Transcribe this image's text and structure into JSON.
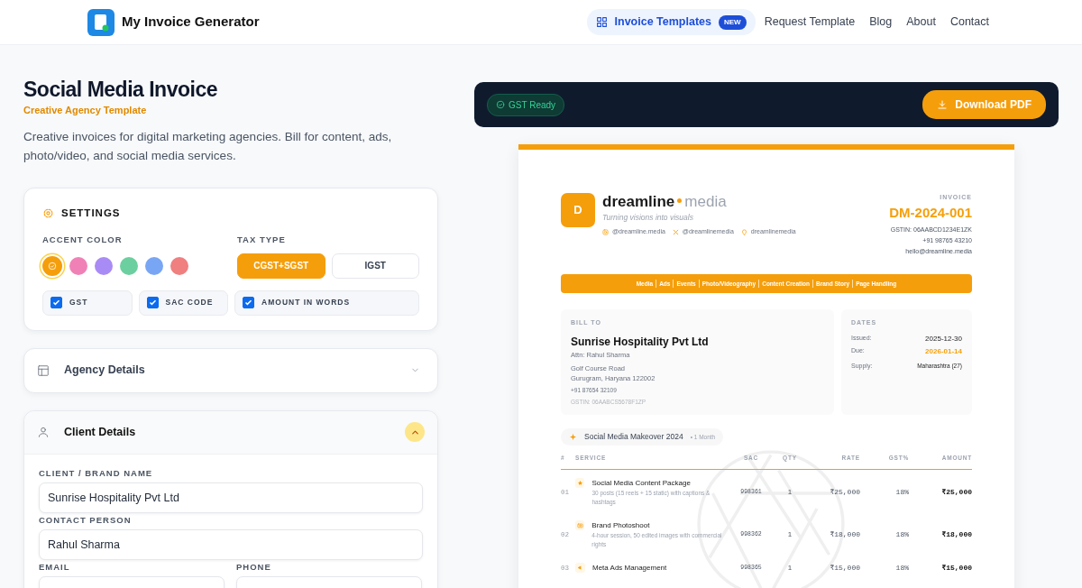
{
  "nav": {
    "brand": "My Invoice Generator",
    "links": [
      {
        "label": "Invoice Templates",
        "selected": true,
        "badge": "NEW",
        "kind": "grid"
      },
      {
        "label": "Request Template",
        "selected": false
      },
      {
        "label": "Blog",
        "selected": false
      },
      {
        "label": "About",
        "selected": false
      },
      {
        "label": "Contact",
        "selected": false
      }
    ]
  },
  "page": {
    "title": "Social Media Invoice",
    "subtitle": "Creative Agency Template",
    "description": "Creative invoices for digital marketing agencies. Bill for content, ads, photo/video, and social media services."
  },
  "settings": {
    "title": "SETTINGS",
    "accent_label": "ACCENT COLOR",
    "accent_colors": [
      {
        "color": "#f59e0b",
        "selected": true
      },
      {
        "color": "#f081b6",
        "selected": false
      },
      {
        "color": "#a98bf5",
        "selected": false
      },
      {
        "color": "#6ccf9f",
        "selected": false
      },
      {
        "color": "#79a6f4",
        "selected": false
      },
      {
        "color": "#f07f7f",
        "selected": false
      }
    ],
    "tax_label": "TAX TYPE",
    "tax_options": [
      {
        "label": "CGST+SGST",
        "selected": true
      },
      {
        "label": "IGST",
        "selected": false
      }
    ],
    "toggles": [
      {
        "label": "GST",
        "checked": true
      },
      {
        "label": "SAC CODE",
        "checked": true
      },
      {
        "label": "AMOUNT IN WORDS",
        "checked": true
      }
    ]
  },
  "sections": [
    {
      "title": "Agency Details",
      "kind": "layout",
      "expanded": false
    },
    {
      "title": "Client Details",
      "kind": "user",
      "expanded": true,
      "fields": [
        {
          "label": "CLIENT / BRAND NAME",
          "value": "Sunrise Hospitality Pvt Ltd",
          "half": false
        },
        {
          "label": "CONTACT PERSON",
          "value": "Rahul Sharma",
          "half": false
        },
        {
          "label": "EMAIL",
          "half": true
        },
        {
          "label": "PHONE",
          "half": true
        }
      ]
    }
  ],
  "preview": {
    "badge": "GST Ready",
    "download": "Download PDF"
  },
  "invoice": {
    "logo_letter": "D",
    "brand_name": "dreamline",
    "brand_suffix": "media",
    "tagline": "Turning visions into visuals",
    "socials": [
      {
        "kind": "instagram",
        "handle": "@dreamline.media"
      },
      {
        "kind": "x",
        "handle": "@dreamlinemedia"
      },
      {
        "kind": "pin",
        "handle": "dreamlinemedia"
      }
    ],
    "doc_label": "INVOICE",
    "number": "DM-2024-001",
    "seller_lines": [
      "GSTIN: 06AABCD1234E1ZK",
      "+91 98765 43210",
      "hello@dreamline.media"
    ],
    "services": [
      "Media",
      "Ads",
      "Events",
      "Photo/Videography",
      "Content Creation",
      "Brand Story",
      "Page Handling"
    ],
    "bill_to": {
      "label": "BILL TO",
      "name": "Sunrise Hospitality Pvt Ltd",
      "attn": "Attn: Rahul Sharma",
      "address": [
        "Golf Course Road",
        "Gurugram, Haryana 122002"
      ],
      "phone": "+91 87654 32109",
      "gstin": "GSTIN: 06AABCS5678F1ZP"
    },
    "dates": {
      "label": "DATES",
      "rows": [
        {
          "label": "Issued:",
          "value": "2025-12-30",
          "highlight": false
        },
        {
          "label": "Due:",
          "value": "2026-01-14",
          "highlight": true
        },
        {
          "label": "Supply:",
          "value": "Maharashtra (27)",
          "highlight": false
        }
      ]
    },
    "project": {
      "name": "Social Media Makeover 2024",
      "duration": "• 1 Month"
    },
    "columns": [
      "#",
      "SERVICE",
      "SAC",
      "QTY",
      "RATE",
      "GST%",
      "AMOUNT"
    ],
    "rows": [
      {
        "no": "01",
        "kind": "star",
        "name": "Social Media Content Package",
        "desc": "30 posts (15 reels + 15 static) with captions & hashtags",
        "sac": "998361",
        "qty": "1",
        "rate": "₹25,000",
        "gst": "18%",
        "amount": "₹25,000"
      },
      {
        "no": "02",
        "kind": "camera",
        "name": "Brand Photoshoot",
        "desc": "4-hour session, 50 edited images with commercial rights",
        "sac": "998362",
        "qty": "1",
        "rate": "₹18,000",
        "gst": "18%",
        "amount": "₹18,000"
      },
      {
        "no": "03",
        "kind": "megaphone",
        "name": "Meta Ads Management",
        "sac": "998365",
        "qty": "1",
        "rate": "₹15,000",
        "gst": "18%",
        "amount": "₹15,000"
      }
    ]
  }
}
